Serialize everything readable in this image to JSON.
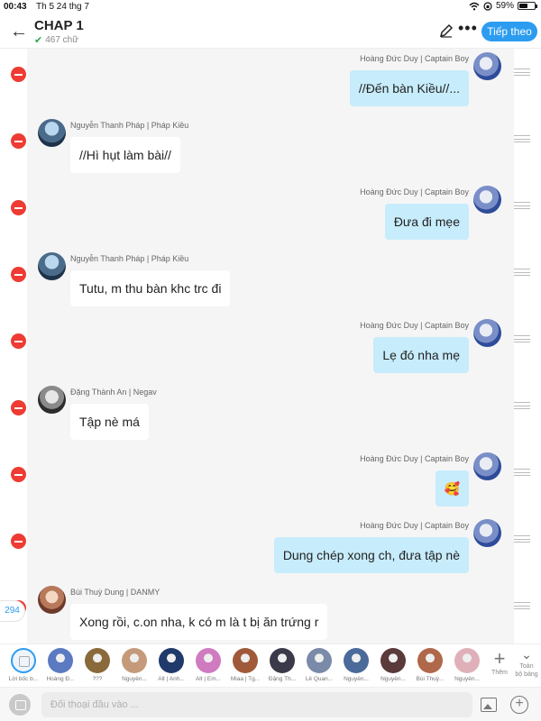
{
  "status": {
    "time": "00:43",
    "date": "Th 5 24 thg 7",
    "battery": "59%",
    "battery_level": 0.59
  },
  "header": {
    "title": "CHAP 1",
    "word_count": "467 chữ",
    "follow_label": "Tiếp theo",
    "back_icon": "arrow-left-icon",
    "edit_icon": "pencil-icon",
    "more_icon": "more-icon"
  },
  "messages": [
    {
      "side": "right",
      "sender": "Hoàng Đức Duy | Captain Boy",
      "avatar": "duy",
      "text": "//Đến bàn Kiều//..."
    },
    {
      "side": "left",
      "sender": "Nguyễn Thanh Pháp | Pháp Kiều",
      "avatar": "phap",
      "text": "//Hì hụt làm bài//"
    },
    {
      "side": "right",
      "sender": "Hoàng Đức Duy | Captain Boy",
      "avatar": "duy",
      "text": "Đưa đi mẹe"
    },
    {
      "side": "left",
      "sender": "Nguyễn Thanh Pháp | Pháp Kiều",
      "avatar": "phap",
      "text": "Tutu, m thu bàn khc trc đi"
    },
    {
      "side": "right",
      "sender": "Hoàng Đức Duy | Captain Boy",
      "avatar": "duy",
      "text": "Lẹ đó nha mẹ"
    },
    {
      "side": "left",
      "sender": "Đặng Thành An | Negav",
      "avatar": "an",
      "text": "Tập nè má"
    },
    {
      "side": "right",
      "sender": "Hoàng Đức Duy | Captain Boy",
      "avatar": "duy",
      "text": "🥰"
    },
    {
      "side": "right",
      "sender": "Hoàng Đức Duy | Captain Boy",
      "avatar": "duy",
      "text": "Dung chép xong ch, đưa tập nè"
    },
    {
      "side": "left",
      "sender": "Bùi Thuỳ Dung | DANMY",
      "avatar": "dung",
      "text": "Xong rồi, c.on nha, k có m là t bị ăn trứng r"
    }
  ],
  "message_count": "294",
  "characters": [
    {
      "name": "Lời bốc b...",
      "type": "narrator"
    },
    {
      "name": "Hoàng Đ...",
      "color": "#5b7ac2"
    },
    {
      "name": "???",
      "color": "#8a6a3a"
    },
    {
      "name": "Nguyễn...",
      "color": "#c49a7a"
    },
    {
      "name": "Alt | Anh...",
      "color": "#203a6b"
    },
    {
      "name": "Alt | Em...",
      "color": "#d07ac0"
    },
    {
      "name": "Miaa | Tg...",
      "color": "#a05a3a"
    },
    {
      "name": "Đặng Th...",
      "color": "#3a3a4a"
    },
    {
      "name": "Lê Quan...",
      "color": "#7a8aa8"
    },
    {
      "name": "Nguyễn...",
      "color": "#4a6a9a"
    },
    {
      "name": "Nguyễn...",
      "color": "#5a3a3a"
    },
    {
      "name": "Bùi Thuỳ...",
      "color": "#b0684a"
    },
    {
      "name": "Nguyễn...",
      "color": "#e0b0b8"
    }
  ],
  "strip": {
    "add_label": "Thêm",
    "all_label_1": "Toàn",
    "all_label_2": "bộ bảng"
  },
  "input": {
    "placeholder": "Đối thoại đầu vào ..."
  },
  "colors": {
    "accent": "#2c9cf0",
    "delete": "#ee3b33",
    "outgoing_bubble": "#c7ecfb"
  }
}
